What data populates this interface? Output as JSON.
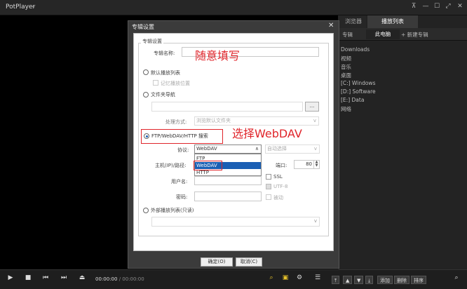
{
  "app": {
    "title": "PotPlayer",
    "chevron": "⌄"
  },
  "window_controls": [
    "⊼",
    "—",
    "☐",
    "⤢",
    "✕"
  ],
  "panel": {
    "tabs": [
      "浏览器",
      "播放列表"
    ],
    "subtabs": [
      "专辑",
      "此电脑",
      "+ 新建专辑"
    ],
    "items": [
      "Downloads",
      "视频",
      "音乐",
      "桌面",
      "[C:] Windows",
      "[D:] Software",
      "[E:] Data",
      "网络"
    ],
    "buttons": [
      "添加",
      "删除",
      "排序"
    ]
  },
  "player": {
    "time": "00:00:00",
    "duration": "/ 00:00:00"
  },
  "dialog": {
    "title": "专辑设置",
    "close": "✕",
    "group": "专辑设置",
    "album_name_label": "专辑名称:",
    "album_name_value": "随意填写",
    "radio_default": "默认播放列表",
    "remember_position": "记忆播放位置",
    "radio_folder": "文件夹导航",
    "browse_button": "...",
    "process_label": "处理方式:",
    "process_value": "浏览默认文件夹",
    "radio_ftp": "FTP/WebDAV/HTTP 搜索",
    "annotation_webdav": "选择WebDAV",
    "protocol_label": "协议:",
    "protocol_value": "WebDAV",
    "protocol_options": [
      "FTP",
      "WebDAV",
      "HTTP"
    ],
    "encoding_value": "自动选择",
    "host_label": "主机(IP)/路径:",
    "port_label": "端口:",
    "port_value": "80",
    "user_label": "用户名:",
    "ssl_label": "SSL",
    "utf8_label": "UTF-8",
    "password_label": "密码:",
    "passive_label": "被动",
    "radio_external": "外部播放列表(只读)",
    "ok_button": "确定(O)",
    "cancel_button": "取消(C)"
  },
  "colors": {
    "annotation": "#e0252b",
    "accent": "#1a5fb4",
    "panel_tab_active": "#3a3a3a"
  }
}
